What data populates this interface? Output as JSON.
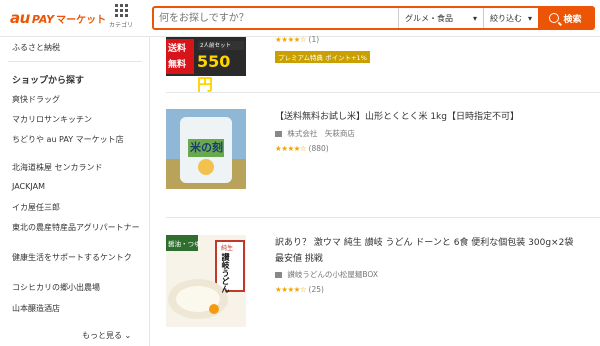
{
  "header": {
    "logo_au": "au",
    "logo_pay": "PAY",
    "logo_market": "マーケット",
    "category_label": "カテゴリ",
    "search_placeholder": "何をお探しですか？",
    "genre_select": "グルメ・食品",
    "filter_select": "絞り込む",
    "search_button": "検索"
  },
  "sidebar": {
    "top_link": "ふるさと納税",
    "shops_heading": "ショップから探す",
    "shops": [
      "爽快ドラッグ",
      "マカリロサンキッチン",
      "ちどりや au PAY マーケット店",
      "北海道株屋 センカランド",
      "JACKJAM",
      "イカ屋任三郎",
      "東北の農産特産品アグリパートナー",
      "健康生活をサポートするケントク",
      "コシヒカリの郷小出農場",
      "山本醸造酒店"
    ],
    "more": "もっと見る"
  },
  "products": [
    {
      "thumb_text_a": "送料",
      "thumb_text_b": "無料",
      "thumb_set": "2人前セット",
      "thumb_price": "550円",
      "rating_count": "(1)",
      "badge": "プレミアム特典 ポイント+1%"
    },
    {
      "title": "【送料無料お試し米】山形とくとく米 1kg【日時指定不可】",
      "shop": "株式会社　矢萩商店",
      "rating_count": "(880)",
      "thumb_label": "米の刻"
    },
    {
      "title": "訳あり？ 激ウマ 純生 讃岐 うどん ドーンと 6食 便利な個包装 300g×2袋",
      "title2": "最安値 挑戦",
      "shop": "讃岐うどんの小松屋麺BOX",
      "rating_count": "(25)",
      "thumb_top": "醤油・つゆ",
      "thumb_label": "讃岐うどん",
      "thumb_tag": "純生"
    }
  ],
  "colors": {
    "accent": "#eb5505",
    "star": "#f0a800"
  }
}
